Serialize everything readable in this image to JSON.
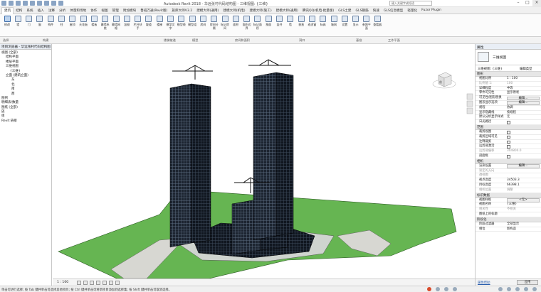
{
  "app": {
    "title": "Autodesk Revit 2018 -    华远张村代码结构图 - 三维视图: {三维}",
    "search_placeholder": "键入关键字或短语"
  },
  "ribbon_tabs": [
    "建筑",
    "结构",
    "系统",
    "插入",
    "注释",
    "分析",
    "体量和场地",
    "协作",
    "视图",
    "管理",
    "附加模块",
    "鲁班万通(Revit版)",
    "族库大师V3.2",
    "建模大师(通用)",
    "建模大师(机电)",
    "建模大师(施工)",
    "建模大师(通用)",
    "腾讯QQ(机电·批量版)",
    "GLS土建",
    "GLS钢筋",
    "快速",
    "GLS信息模型",
    "轻量化",
    "Fuzor Plugin"
  ],
  "ribbon_buttons": [
    "修改",
    "墙",
    "门",
    "窗",
    "构件",
    "柱",
    "屋顶",
    "天花板",
    "楼板",
    "幕墙系统",
    "幕墙网格",
    "竖梃",
    "栏杆扶手",
    "坡道",
    "楼梯",
    "模型文字",
    "模型线",
    "模型组",
    "房间",
    "房间分隔",
    "标记房间",
    "面积",
    "面积边界",
    "标记面积",
    "按面",
    "竖井",
    "墙",
    "垂直",
    "老虎窗",
    "标高",
    "轴网",
    "设置",
    "显示",
    "参照平面",
    "查看器"
  ],
  "panel_labels": [
    "选择",
    "构建",
    "楼梯坡道",
    "模型",
    "房间和面积",
    "洞口",
    "基准",
    "工作平面"
  ],
  "project_browser": {
    "title": "项目浏览器 - 华远张村代码结构图",
    "items": [
      "视图 (全部)",
      "结构平面",
      "楼层平面",
      "三维视图",
      "{三维}",
      "立面 (建筑立面)",
      "东",
      "北",
      "南",
      "西",
      "图例",
      "明细表/数量",
      "图纸 (全部)",
      "族",
      "组",
      "Revit 链接"
    ]
  },
  "view": {
    "scale": "1 : 100",
    "viewcube_label": "前"
  },
  "properties": {
    "title": "属性",
    "type_name": "三维视图",
    "selector": "三维视图: {三维}",
    "edit_type": "编辑类型",
    "sections": [
      {
        "title": "图形",
        "rows": [
          {
            "k": "视图比例",
            "v": "1 : 100",
            "kind": "text"
          },
          {
            "k": "比例值 1:",
            "v": "100",
            "kind": "text",
            "dis": true
          },
          {
            "k": "详细程度",
            "v": "中等",
            "kind": "text"
          },
          {
            "k": "零件可见性",
            "v": "显示原状",
            "kind": "text"
          },
          {
            "k": "可见性/图形替换",
            "v": "编辑...",
            "kind": "button"
          },
          {
            "k": "图形显示选项",
            "v": "编辑...",
            "kind": "button"
          },
          {
            "k": "规程",
            "v": "协调",
            "kind": "text"
          },
          {
            "k": "显示隐藏线",
            "v": "按规程",
            "kind": "text"
          },
          {
            "k": "默认分析显示样式",
            "v": "无",
            "kind": "text"
          },
          {
            "k": "日光路径",
            "v": "",
            "kind": "check",
            "on": false
          }
        ]
      },
      {
        "title": "范围",
        "rows": [
          {
            "k": "裁剪视图",
            "v": "",
            "kind": "check",
            "on": false
          },
          {
            "k": "裁剪区域可见",
            "v": "",
            "kind": "check",
            "on": false
          },
          {
            "k": "注释裁剪",
            "v": "",
            "kind": "check",
            "on": false
          },
          {
            "k": "远剪裁激活",
            "v": "",
            "kind": "check",
            "on": false
          },
          {
            "k": "远剪裁偏移",
            "v": "304800.0",
            "kind": "text",
            "dis": true
          },
          {
            "k": "剖面框",
            "v": "",
            "kind": "check",
            "on": false
          }
        ]
      },
      {
        "title": "相机",
        "rows": [
          {
            "k": "渲染设置",
            "v": "编辑...",
            "kind": "button"
          },
          {
            "k": "锁定的方向",
            "v": "",
            "kind": "text",
            "dis": true
          },
          {
            "k": "透视图",
            "v": "",
            "kind": "text",
            "dis": true
          },
          {
            "k": "视点高度",
            "v": "34503.3",
            "kind": "text"
          },
          {
            "k": "目标高度",
            "v": "66398.1",
            "kind": "text"
          },
          {
            "k": "相机位置",
            "v": "调整",
            "kind": "text",
            "dis": true
          }
        ]
      },
      {
        "title": "标识数据",
        "rows": [
          {
            "k": "视图样板",
            "v": "<无>",
            "kind": "button"
          },
          {
            "k": "视图名称",
            "v": "{三维}",
            "kind": "text"
          },
          {
            "k": "相关性",
            "v": "不相关",
            "kind": "text",
            "dis": true
          },
          {
            "k": "图纸上的标题",
            "v": "",
            "kind": "text"
          }
        ]
      },
      {
        "title": "阶段化",
        "rows": [
          {
            "k": "阶段过滤器",
            "v": "全部显示",
            "kind": "text"
          },
          {
            "k": "相位",
            "v": "新构造",
            "kind": "text"
          }
        ]
      }
    ],
    "help_link": "属性帮助",
    "apply": "应用"
  },
  "status": {
    "message": "单击可进行选择; 按 Tab 键并单击可选择其他项目; 按 Ctrl 键并单击可将新项目添加到选择集; 按 Shift 键并单击可取消选择。"
  },
  "colors": {
    "ground": "#66b552",
    "building": "#1c2430",
    "paving": "#d7d7d2",
    "accent": "#3d6ca8"
  }
}
